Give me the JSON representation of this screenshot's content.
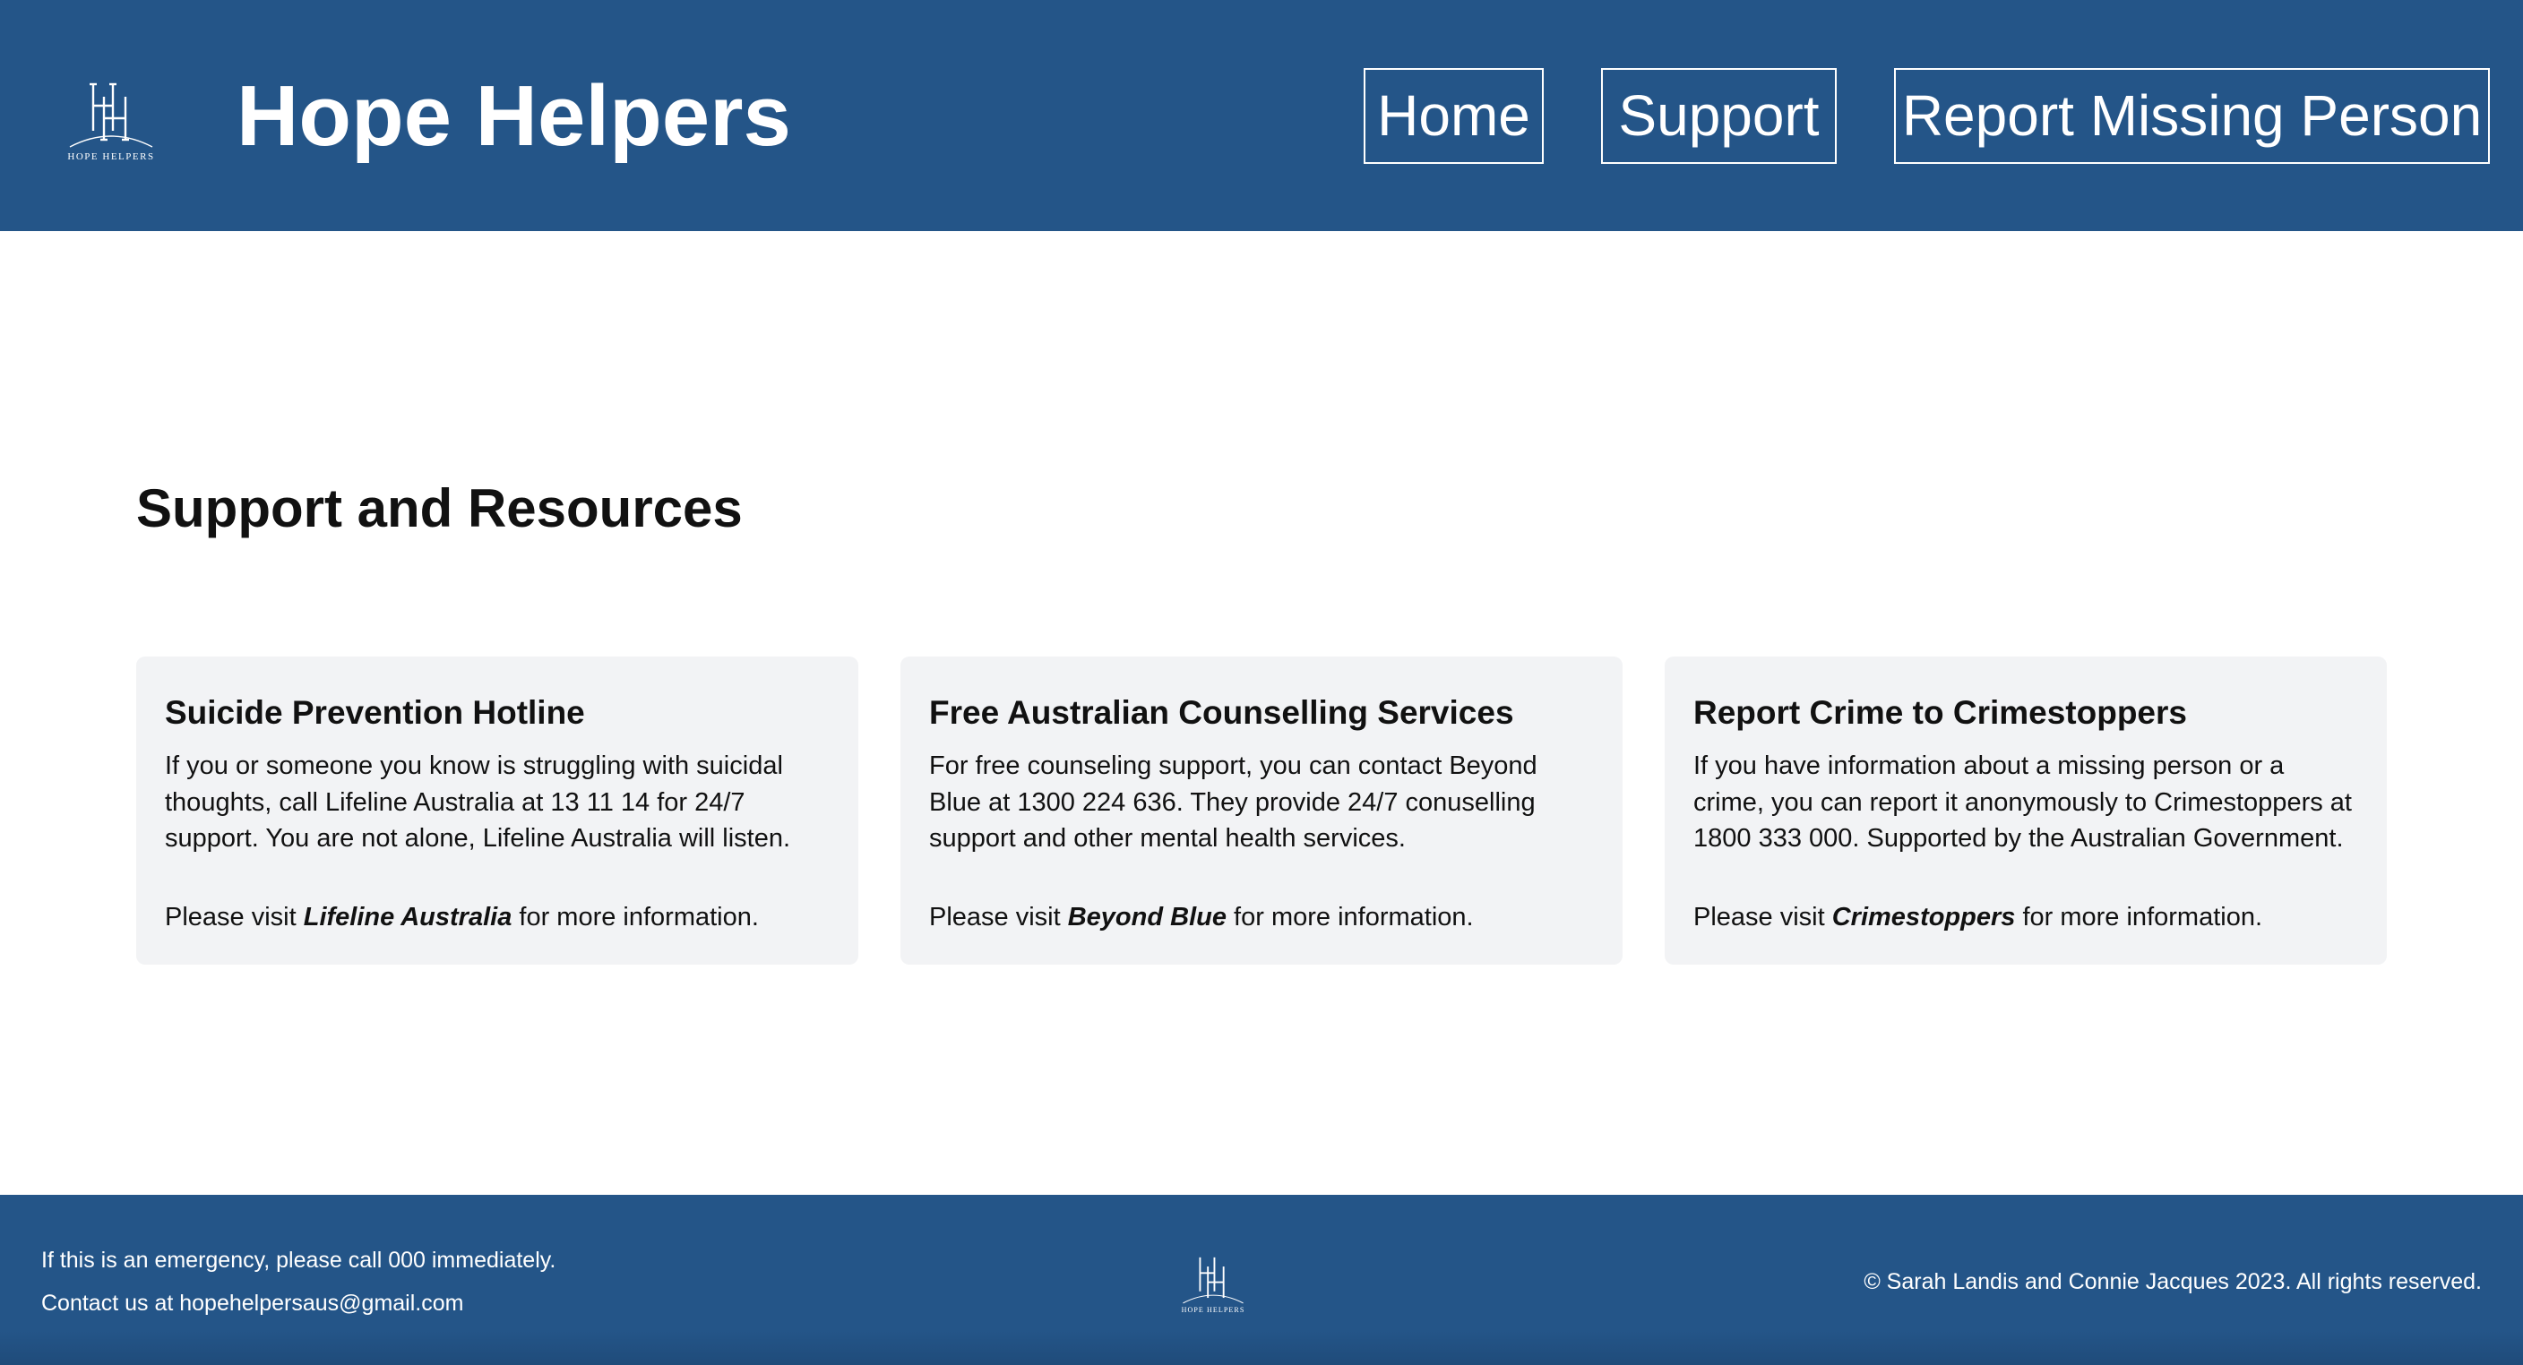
{
  "header": {
    "logo_icon": "hh-monogram-logo",
    "logo_text": "HOPE HELPERS",
    "title": "Hope Helpers",
    "background_color": "#245588",
    "nav": [
      {
        "label": "Home"
      },
      {
        "label": "Support"
      },
      {
        "label": "Report Missing Person"
      }
    ]
  },
  "main": {
    "title": "Support and Resources",
    "cards": [
      {
        "title": "Suicide Prevention Hotline",
        "description": "If you or someone you know is struggling with suicidal thoughts, call Lifeline Australia at 13 11 14 for 24/7 support. You are not alone, Lifeline Australia will listen.",
        "visit_prefix": "Please visit ",
        "visit_link": "Lifeline Australia",
        "visit_suffix": " for more information."
      },
      {
        "title": "Free Australian Counselling Services",
        "description": "For free counseling support, you can contact Beyond Blue at 1300 224 636. They provide 24/7 conuselling support and other mental health services.",
        "visit_prefix": "Please visit ",
        "visit_link": "Beyond Blue",
        "visit_suffix": " for more information."
      },
      {
        "title": "Report Crime to Crimestoppers",
        "description": "If you have information about a missing person or a crime, you can report it anonymously to Crimestoppers at 1800 333 000. Supported by the Australian Government.",
        "visit_prefix": "Please visit ",
        "visit_link": "Crimestoppers",
        "visit_suffix": " for more information."
      }
    ]
  },
  "footer": {
    "emergency": "If this is an emergency, please call 000 immediately.",
    "contact": "Contact us at hopehelpersaus@gmail.com",
    "logo_icon": "hh-monogram-logo",
    "logo_text": "HOPE HELPERS",
    "copyright": "© Sarah Landis and Connie Jacques 2023. All rights reserved."
  }
}
